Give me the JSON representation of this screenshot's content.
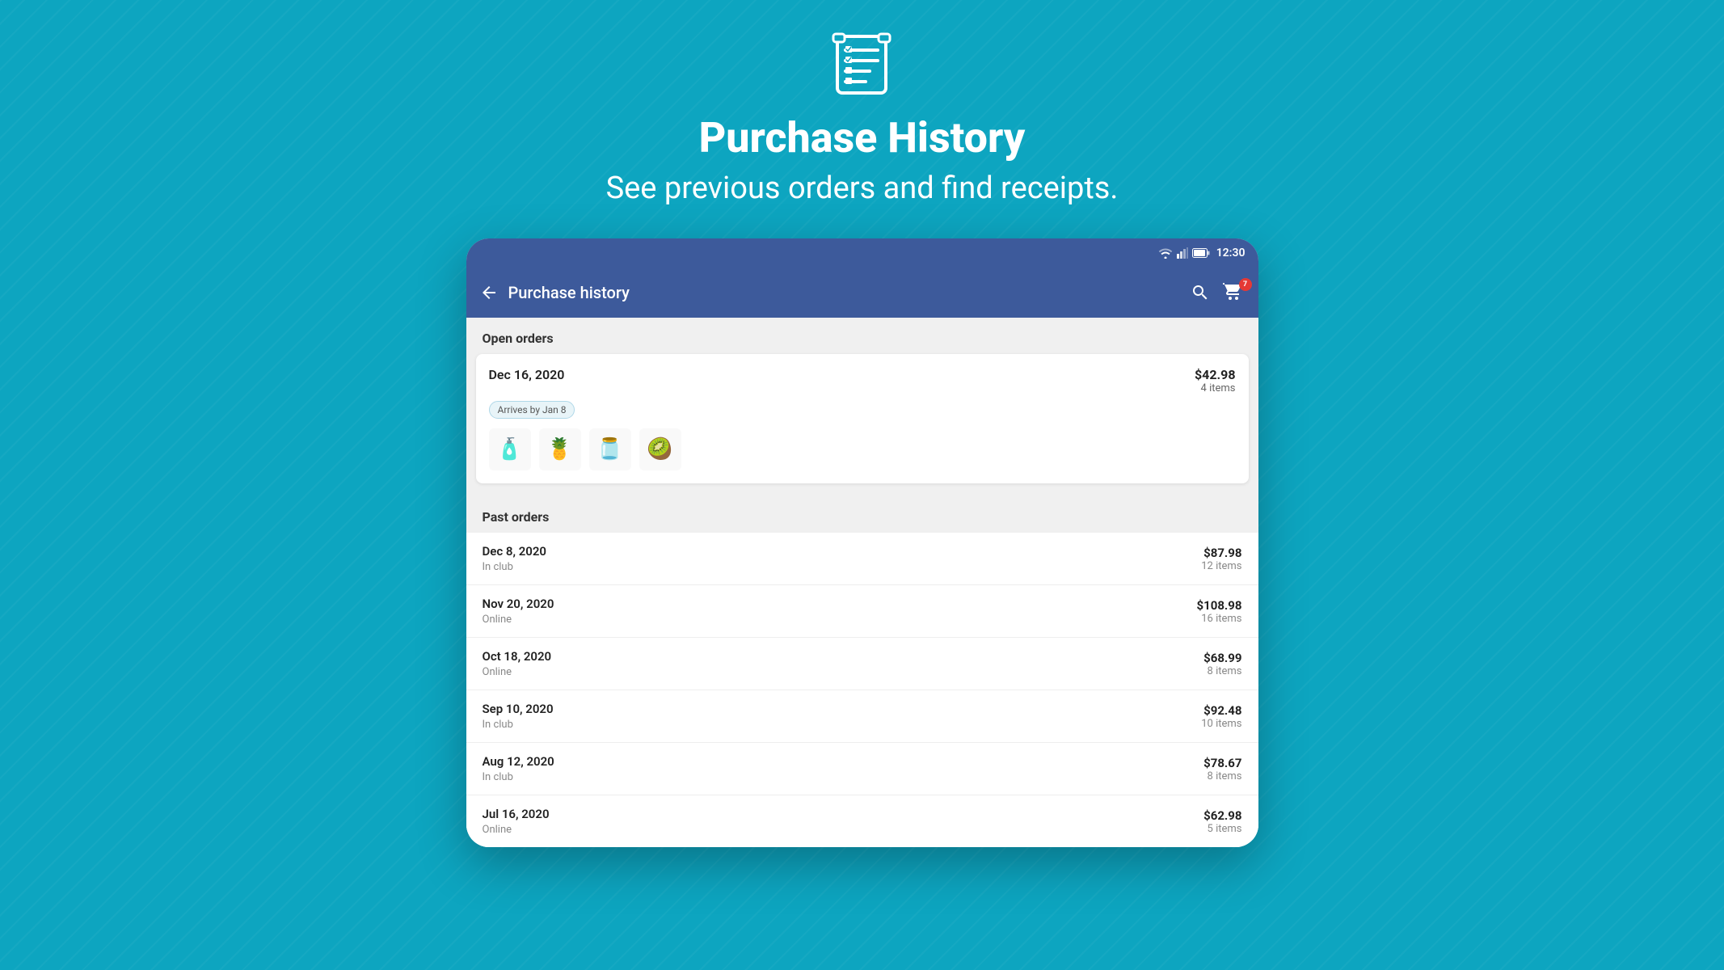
{
  "background_color": "#0da5c0",
  "hero": {
    "title": "Purchase History",
    "subtitle": "See previous orders and find receipts."
  },
  "status_bar": {
    "time": "12:30"
  },
  "app_bar": {
    "title": "Purchase history",
    "back_label": "back",
    "search_label": "search",
    "cart_label": "cart",
    "cart_badge": "7"
  },
  "open_orders_section": {
    "label": "Open orders",
    "order": {
      "date": "Dec 16, 2020",
      "arrives_badge": "Arrives by Jan 8",
      "total": "$42.98",
      "items_count": "4 items",
      "products": [
        "🧴",
        "🍍",
        "🫙",
        "🥝"
      ]
    }
  },
  "past_orders_section": {
    "label": "Past orders",
    "orders": [
      {
        "date": "Dec 8, 2020",
        "type": "In club",
        "total": "$87.98",
        "items": "12 items"
      },
      {
        "date": "Nov 20, 2020",
        "type": "Online",
        "total": "$108.98",
        "items": "16 items"
      },
      {
        "date": "Oct 18, 2020",
        "type": "Online",
        "total": "$68.99",
        "items": "8 items"
      },
      {
        "date": "Sep 10, 2020",
        "type": "In club",
        "total": "$92.48",
        "items": "10 items"
      },
      {
        "date": "Aug 12, 2020",
        "type": "In club",
        "total": "$78.67",
        "items": "8 items"
      },
      {
        "date": "Jul 16, 2020",
        "type": "Online",
        "total": "$62.98",
        "items": "5 items"
      }
    ]
  }
}
